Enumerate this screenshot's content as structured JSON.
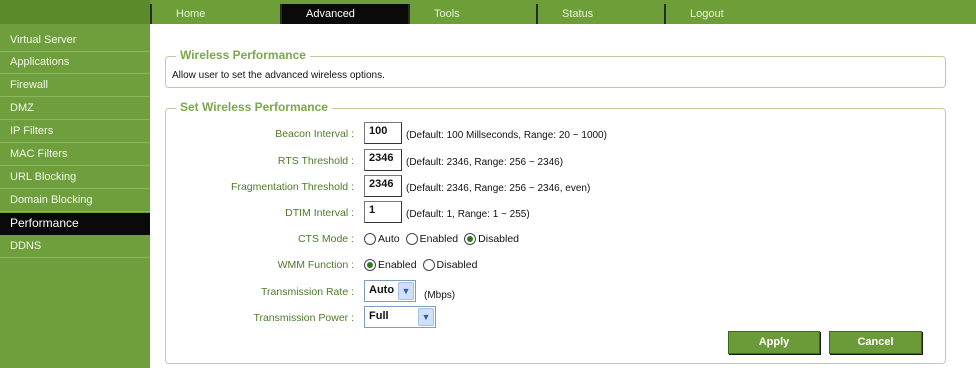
{
  "nav": {
    "tabs": [
      {
        "label": "Home"
      },
      {
        "label": "Advanced"
      },
      {
        "label": "Tools"
      },
      {
        "label": "Status"
      },
      {
        "label": "Logout"
      }
    ],
    "active": "Advanced"
  },
  "sidebar": {
    "items": [
      {
        "label": "Virtual Server"
      },
      {
        "label": "Applications"
      },
      {
        "label": "Firewall"
      },
      {
        "label": "DMZ"
      },
      {
        "label": "IP Filters"
      },
      {
        "label": "MAC Filters"
      },
      {
        "label": "URL Blocking"
      },
      {
        "label": "Domain Blocking"
      },
      {
        "label": "Performance"
      },
      {
        "label": "DDNS"
      }
    ],
    "active": "Performance"
  },
  "wireless_performance": {
    "legend": "Wireless Performance",
    "description": "Allow user to set the advanced wireless options."
  },
  "settings": {
    "legend": "Set Wireless Performance",
    "beacon_interval": {
      "label": "Beacon Interval :",
      "value": "100",
      "hint": "(Default: 100 Millseconds, Range: 20 ~ 1000)"
    },
    "rts_threshold": {
      "label": "RTS Threshold :",
      "value": "2346",
      "hint": "(Default: 2346, Range: 256 ~ 2346)"
    },
    "fragmentation_threshold": {
      "label": "Fragmentation Threshold :",
      "value": "2346",
      "hint": "(Default: 2346, Range: 256 ~ 2346, even)"
    },
    "dtim_interval": {
      "label": "DTIM Interval :",
      "value": "1",
      "hint": "(Default: 1, Range: 1 ~ 255)"
    },
    "cts_mode": {
      "label": "CTS Mode :",
      "options": [
        "Auto",
        "Enabled",
        "Disabled"
      ],
      "selected": "Disabled"
    },
    "wmm_function": {
      "label": "WMM Function :",
      "options": [
        "Enabled",
        "Disabled"
      ],
      "selected": "Enabled"
    },
    "transmission_rate": {
      "label": "Transmission Rate :",
      "value": "Auto",
      "unit": "(Mbps)"
    },
    "transmission_power": {
      "label": "Transmission Power :",
      "value": "Full"
    }
  },
  "buttons": {
    "apply": "Apply",
    "cancel": "Cancel"
  },
  "colors": {
    "accent_green": "#6e9e38",
    "active_black": "#0a0a0a",
    "label_green": "#4d7a26"
  },
  "icons": {
    "select_arrow": "chevron-down-icon"
  }
}
